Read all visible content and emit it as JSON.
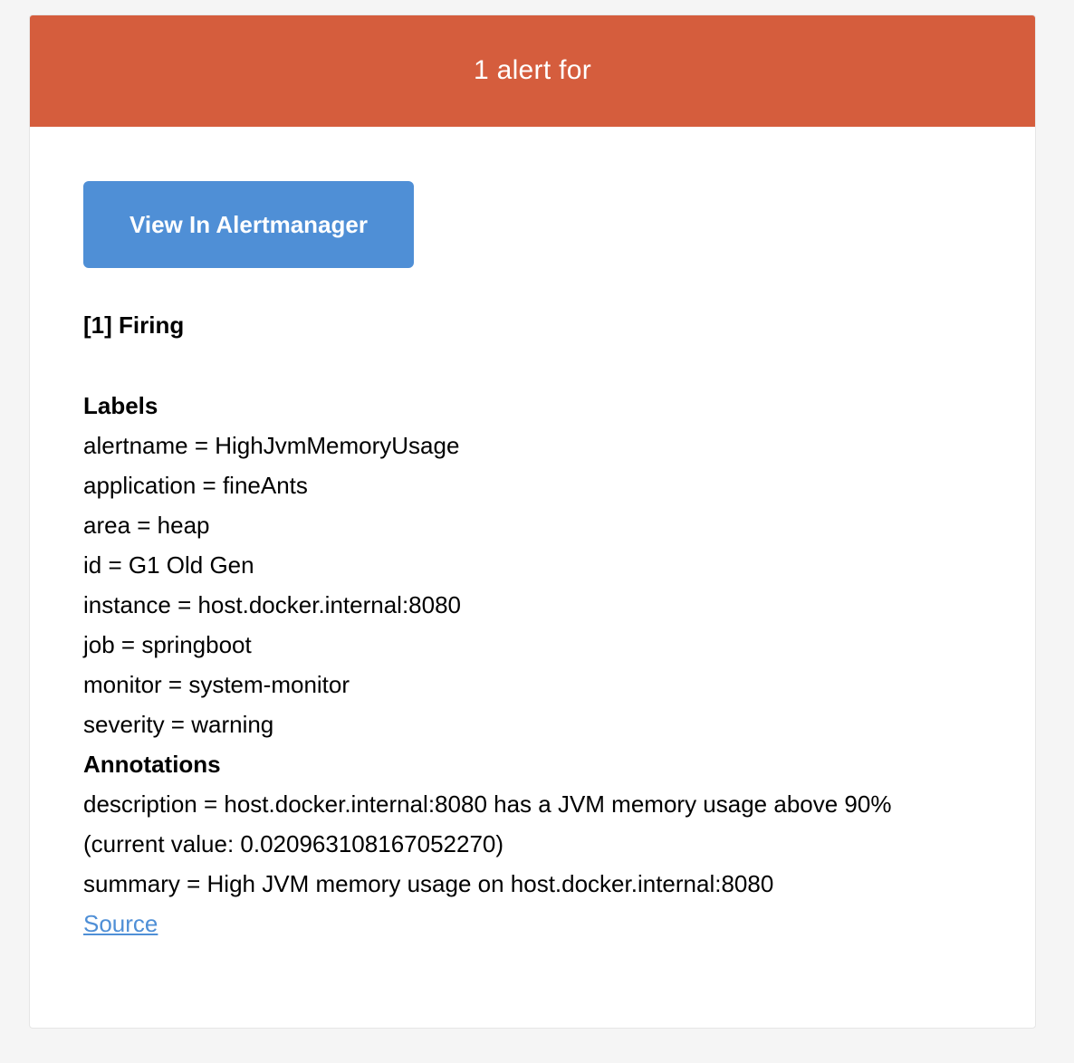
{
  "header": {
    "title": "1 alert for"
  },
  "colors": {
    "header_background": "#d55d3d",
    "button_background": "#4f8fd6",
    "link": "#4f8fd6",
    "page_background": "#f5f5f5"
  },
  "button": {
    "label": "View In Alertmanager"
  },
  "firing": {
    "title": "[1] Firing"
  },
  "labels": {
    "heading": "Labels",
    "items": [
      "alertname = HighJvmMemoryUsage",
      "application = fineAnts",
      "area = heap",
      "id = G1 Old Gen",
      "instance = host.docker.internal:8080",
      "job = springboot",
      "monitor = system-monitor",
      "severity = warning"
    ]
  },
  "annotations": {
    "heading": "Annotations",
    "items": [
      "description = host.docker.internal:8080 has a JVM memory usage above 90%",
      "(current value: 0.020963108167052270)",
      "summary = High JVM memory usage on host.docker.internal:8080"
    ]
  },
  "source": {
    "label": "Source"
  }
}
